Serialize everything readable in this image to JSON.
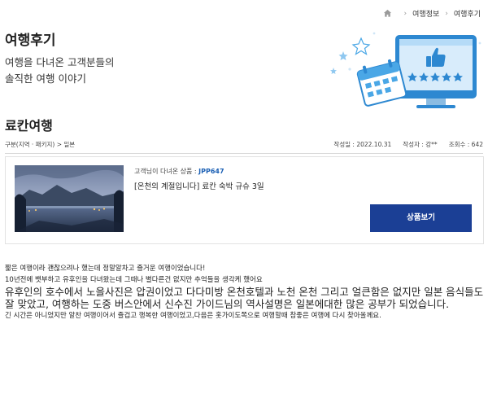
{
  "breadcrumb": {
    "items": [
      "여행정보",
      "여행후기"
    ]
  },
  "header": {
    "title": "여행후기",
    "subtitle_line1": "여행을 다녀온 고객분들의",
    "subtitle_line2": "솔직한 여행 이야기"
  },
  "post": {
    "title": "료칸여행",
    "category": "구분(지역 · 패키지) > 일본",
    "date": "작성일 : 2022.10.31",
    "author": "작성자 : 강**",
    "views": "조회수 : 642"
  },
  "product": {
    "label_prefix": "고객님이 다녀온 상품 : ",
    "code": "JPP647",
    "name": "[온천의 계절입니다] 료칸 숙박 규슈 3일",
    "button_label": "상품보기"
  },
  "body": {
    "p1": "짧은 여행이라 괜찮으려나 했는데 정말알차고 즐거운 여행이었습니다!",
    "p2": "10년전에 뱃부하고 유후인을 다녀왔는데 그때나 별다른건 없지만 추억들을 생각케 했어요",
    "p3": "유후인의 호수에서 노을사진은 압권이었고 다다미방 온천호텔과 노천 온천 그리고 얼큰함은 없지만 일본 음식들도 잘 맞았고, 여행하는 도중 버스안에서 신수진 가이드님의 역사설명은 일본에대한 많은 공부가 되었습니다.",
    "p4": "긴 시간은 아니었지만 알찬 여행이어서 즐겁고 행복한 여행이었고,다음은 홋가이도쪽으로 여행할때 참좋은 여행에 다시 찾아올께요."
  },
  "colors": {
    "accent": "#1b3f95",
    "code": "#1a5fb4",
    "hero_blue": "#4aa7e6"
  },
  "icons": [
    "home-icon",
    "chevron-right-icon",
    "calendar-icon",
    "monitor-icon",
    "thumbs-up-icon",
    "star-icon",
    "sparkle-icon"
  ]
}
